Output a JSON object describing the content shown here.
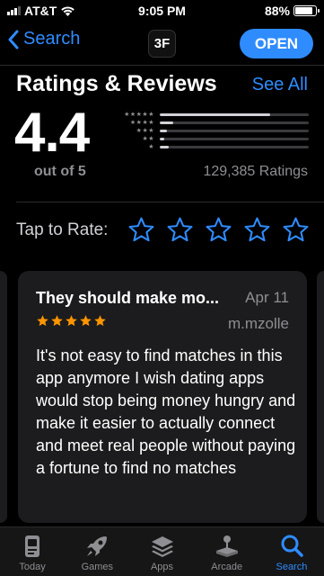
{
  "status_bar": {
    "carrier": "AT&T",
    "time": "9:05 PM",
    "battery": "88%",
    "battery_level": 0.88
  },
  "nav": {
    "back_label": "Search",
    "app_icon_text": "3F",
    "open_label": "OPEN"
  },
  "ratings": {
    "title": "Ratings & Reviews",
    "see_all": "See All",
    "score": "4.4",
    "out_of": "out of 5",
    "count": "129,385 Ratings",
    "distribution": [
      {
        "stars": "★★★★★",
        "fraction": 0.74
      },
      {
        "stars": "★★★★",
        "fraction": 0.09
      },
      {
        "stars": "★★★",
        "fraction": 0.05
      },
      {
        "stars": "★★",
        "fraction": 0.03
      },
      {
        "stars": "★",
        "fraction": 0.06
      }
    ]
  },
  "tap_to_rate": {
    "label": "Tap to Rate:",
    "star_count": 5
  },
  "review": {
    "title": "They should make mo...",
    "date": "Apr 11",
    "author": "m.mzolle",
    "rating": 5,
    "body": "It's not easy to find matches in this app anymore I wish dating apps would stop being money hungry and make it easier to actually connect and meet real people without paying a fortune to find no matches"
  },
  "tabs": [
    {
      "label": "Today",
      "icon": "today-icon",
      "active": false
    },
    {
      "label": "Games",
      "icon": "rocket-icon",
      "active": false
    },
    {
      "label": "Apps",
      "icon": "layers-icon",
      "active": false
    },
    {
      "label": "Arcade",
      "icon": "joystick-icon",
      "active": false
    },
    {
      "label": "Search",
      "icon": "search-icon",
      "active": true
    }
  ],
  "colors": {
    "accent": "#2f8cff",
    "review_star": "#ff9500",
    "background": "#000000",
    "card": "#1c1c1e"
  }
}
